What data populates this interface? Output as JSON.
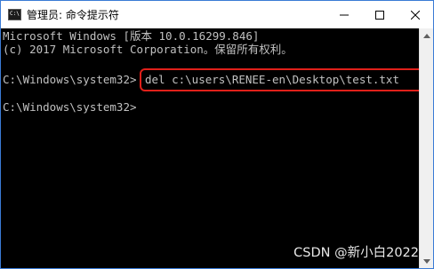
{
  "window": {
    "title": "管理员: 命令提示符",
    "icon": "cmd-icon",
    "icon_text": "C:\\",
    "border_color": "#3a7bd5"
  },
  "controls": {
    "minimize_icon": "minimize-icon",
    "maximize_icon": "maximize-icon",
    "close_icon": "close-icon"
  },
  "console": {
    "lines": [
      "Microsoft Windows [版本 10.0.16299.846]",
      "(c) 2017 Microsoft Corporation。保留所有权利。",
      "",
      "C:\\Windows\\system32>",
      "",
      "C:\\Windows\\system32>"
    ],
    "command": "del c:\\users\\RENEE-en\\Desktop\\test.txt",
    "text_color": "#c0c0c0",
    "background": "#000000",
    "highlight_color": "#e0201a"
  },
  "scrollbar": {
    "up_icon": "scroll-up-icon",
    "down_icon": "scroll-down-icon"
  },
  "watermark": "CSDN @新小白2022"
}
